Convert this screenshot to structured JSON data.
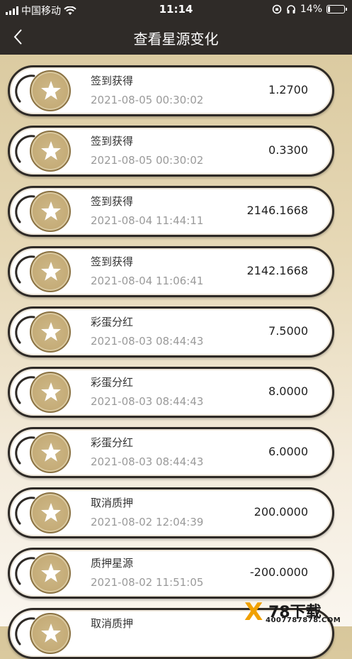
{
  "status_bar": {
    "carrier": "中国移动",
    "time": "11:14",
    "battery": "14%"
  },
  "nav": {
    "title": "查看星源变化"
  },
  "records": [
    {
      "label": "签到获得",
      "time": "2021-08-05 00:30:02",
      "amount": "1.2700"
    },
    {
      "label": "签到获得",
      "time": "2021-08-05 00:30:02",
      "amount": "0.3300"
    },
    {
      "label": "签到获得",
      "time": "2021-08-04 11:44:11",
      "amount": "2146.1668"
    },
    {
      "label": "签到获得",
      "time": "2021-08-04 11:06:41",
      "amount": "2142.1668"
    },
    {
      "label": "彩蛋分红",
      "time": "2021-08-03 08:44:43",
      "amount": "7.5000"
    },
    {
      "label": "彩蛋分红",
      "time": "2021-08-03 08:44:43",
      "amount": "8.0000"
    },
    {
      "label": "彩蛋分红",
      "time": "2021-08-03 08:44:43",
      "amount": "6.0000"
    },
    {
      "label": "取消质押",
      "time": "2021-08-02 12:04:39",
      "amount": "200.0000"
    },
    {
      "label": "质押星源",
      "time": "2021-08-02 11:51:05",
      "amount": "-200.0000"
    },
    {
      "label": "取消质押",
      "time": "",
      "amount": ""
    }
  ],
  "watermark": {
    "name": "78下载",
    "url": "4007787878.COM"
  },
  "icons": {
    "record_icon": "star-coin-icon",
    "back": "chevron-left-icon"
  }
}
